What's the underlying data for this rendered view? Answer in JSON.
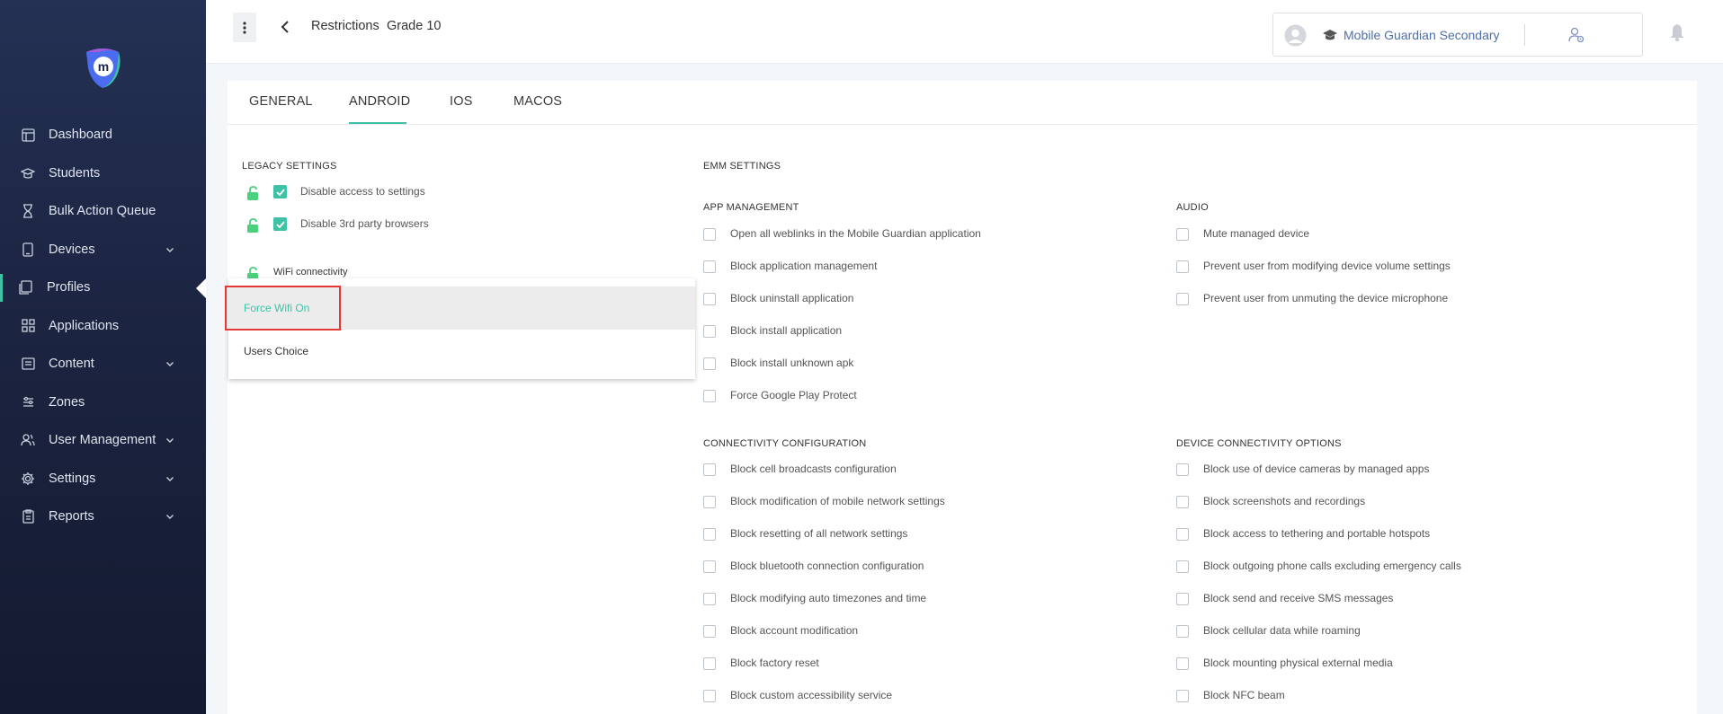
{
  "sidebar": {
    "items": [
      {
        "label": "Dashboard",
        "icon": "dashboard-icon",
        "has_chevron": false
      },
      {
        "label": "Students",
        "icon": "students-icon",
        "has_chevron": false
      },
      {
        "label": "Bulk Action Queue",
        "icon": "hourglass-icon",
        "has_chevron": false
      },
      {
        "label": "Devices",
        "icon": "device-icon",
        "has_chevron": true
      },
      {
        "label": "Profiles",
        "icon": "profiles-icon",
        "has_chevron": false,
        "active": true
      },
      {
        "label": "Applications",
        "icon": "applications-icon",
        "has_chevron": false
      },
      {
        "label": "Content",
        "icon": "content-icon",
        "has_chevron": true
      },
      {
        "label": "Zones",
        "icon": "zones-icon",
        "has_chevron": false
      },
      {
        "label": "User Management",
        "icon": "users-icon",
        "has_chevron": true
      },
      {
        "label": "Settings",
        "icon": "gear-icon",
        "has_chevron": true
      },
      {
        "label": "Reports",
        "icon": "reports-icon",
        "has_chevron": true
      }
    ]
  },
  "header": {
    "breadcrumb": [
      "Restrictions",
      "Grade 10"
    ],
    "school_name": "Mobile Guardian Secondary"
  },
  "tabs": [
    {
      "label": "GENERAL"
    },
    {
      "label": "ANDROID",
      "active": true
    },
    {
      "label": "IOS"
    },
    {
      "label": "MACOS"
    }
  ],
  "legacy": {
    "title": "LEGACY SETTINGS",
    "items": [
      {
        "label": "Disable access to settings",
        "checked": true
      },
      {
        "label": "Disable 3rd party browsers",
        "checked": true
      }
    ],
    "wifi_label": "WiFi connectivity"
  },
  "dropdown": {
    "options": [
      "Force Wifi On",
      "Users Choice"
    ],
    "selected": "Force Wifi On"
  },
  "emm": {
    "title": "EMM SETTINGS",
    "app_management": {
      "title": "APP MANAGEMENT",
      "items": [
        "Open all weblinks in the Mobile Guardian application",
        "Block application management",
        "Block uninstall application",
        "Block install application",
        "Block install unknown apk",
        "Force Google Play Protect"
      ]
    },
    "audio": {
      "title": "AUDIO",
      "items": [
        "Mute managed device",
        "Prevent user from modifying device volume settings",
        "Prevent user from unmuting the device microphone"
      ]
    },
    "connectivity": {
      "title": "CONNECTIVITY CONFIGURATION",
      "items": [
        "Block cell broadcasts configuration",
        "Block modification of mobile network settings",
        "Block resetting of all network settings",
        "Block bluetooth connection configuration",
        "Block modifying auto timezones and time",
        "Block account modification",
        "Block factory reset",
        "Block custom accessibility service"
      ]
    },
    "device_connectivity": {
      "title": "DEVICE CONNECTIVITY OPTIONS",
      "items": [
        "Block use of device cameras by managed apps",
        "Block screenshots and recordings",
        "Block access to tethering and portable hotspots",
        "Block outgoing phone calls excluding emergency calls",
        "Block send and receive SMS messages",
        "Block cellular data while roaming",
        "Block mounting physical external media",
        "Block NFC beam"
      ]
    }
  },
  "colors": {
    "accent": "#3fc1a5",
    "sidebar_bg": "#1b2441",
    "highlight": "#e53935",
    "link": "#4f6fa8"
  }
}
